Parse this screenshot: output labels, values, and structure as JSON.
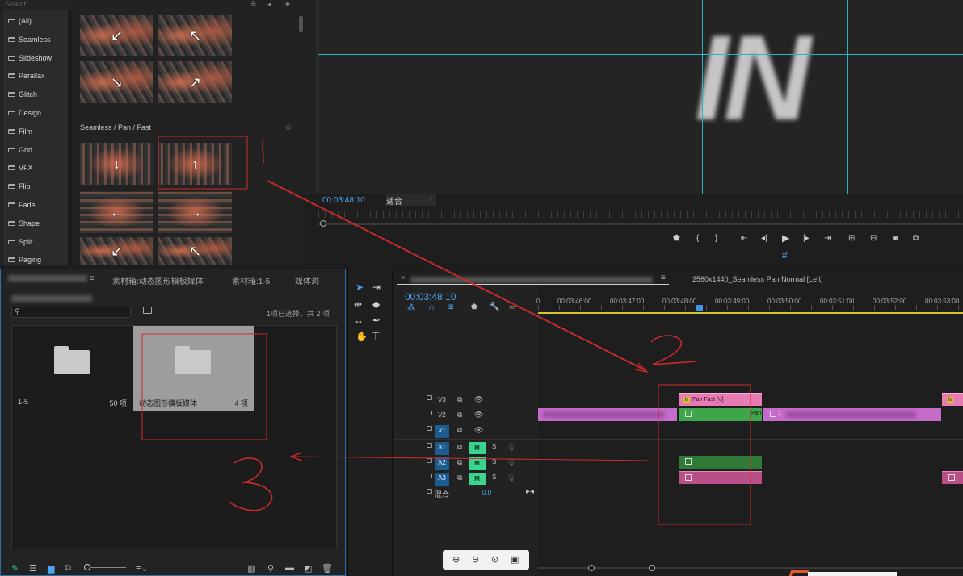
{
  "browser": {
    "search_placeholder": "Search",
    "categories": [
      "(All)",
      "Seamless",
      "Slideshow",
      "Parallax",
      "Glitch",
      "Design",
      "Film",
      "Grid",
      "VFX",
      "Flip",
      "Fade",
      "Shape",
      "Split",
      "Paging"
    ],
    "section_label": "Seamless / Pan / Fast",
    "star_icon": "star-icon",
    "thumb_arrows": [
      "↙",
      "↖",
      "↘",
      "↗",
      "↓",
      "↑",
      "←",
      "→",
      "↙",
      "↖"
    ]
  },
  "monitor": {
    "timecode": "00:03:48:10",
    "fit": "适合",
    "overlay_text": "IN",
    "guide_color": "#2bb3c5"
  },
  "project": {
    "tabs": [
      "素材箱:动态图形模板媒体",
      "素材箱:1-5",
      "媒体浏"
    ],
    "selection_status": "1项已选择，共 2 项",
    "bins": [
      {
        "name": "1-5",
        "count": "50 项"
      },
      {
        "name": "动态图形模板媒体",
        "count": "4 项"
      }
    ]
  },
  "timeline": {
    "title": "2560x1440_Seamless Pan Normal [Left]",
    "timecode": "00:03:48:10",
    "ruler": [
      "00:03:46:00",
      "00:03:47:00",
      "00:03:48:00",
      "00:03:49:00",
      "00:03:50:00",
      "00:03:51:00",
      "00:03:52:00",
      "00:03:53:00"
    ],
    "ruler_start": "0",
    "tracks": {
      "video": [
        "V3",
        "V2",
        "V1"
      ],
      "audio": [
        "A1",
        "A2",
        "A3"
      ],
      "mute": "M",
      "solo": "S"
    },
    "mix_label": "混合",
    "mix_value": "0.0",
    "clips": {
      "v3_label": "Pan Fast [V]",
      "v2_label": "Pan",
      "v2_b_label": "1",
      "fx_badge": "fx"
    }
  },
  "annotations": {
    "color": "#d42a2a",
    "numbers": [
      "1",
      "2",
      "3"
    ]
  }
}
